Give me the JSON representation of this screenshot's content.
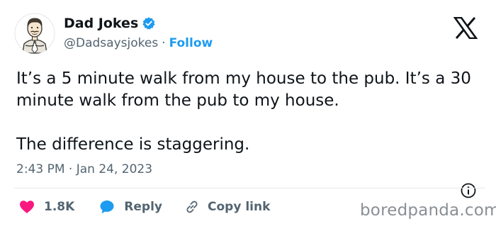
{
  "author": {
    "name": "Dad Jokes",
    "handle": "@Dadsaysjokes",
    "separator": "·",
    "follow_label": "Follow",
    "avatar_icon": "cartoon-dad-avatar",
    "verified_icon": "verified-badge-icon"
  },
  "platform_icon": "x-logo-icon",
  "tweet": {
    "paragraphs": [
      "It’s a 5 minute walk from my house to the pub. It’s a 30 minute walk from the pub to my house.",
      "The difference is staggering."
    ],
    "timestamp": "2:43 PM · Jan 24, 2023"
  },
  "actions": {
    "likes": "1.8K",
    "reply_label": "Reply",
    "copy_link_label": "Copy link"
  },
  "watermark": "boredpanda.com",
  "colors": {
    "accent": "#1d9bf0",
    "like": "#f91880",
    "text": "#0f1419",
    "muted": "#536471"
  }
}
